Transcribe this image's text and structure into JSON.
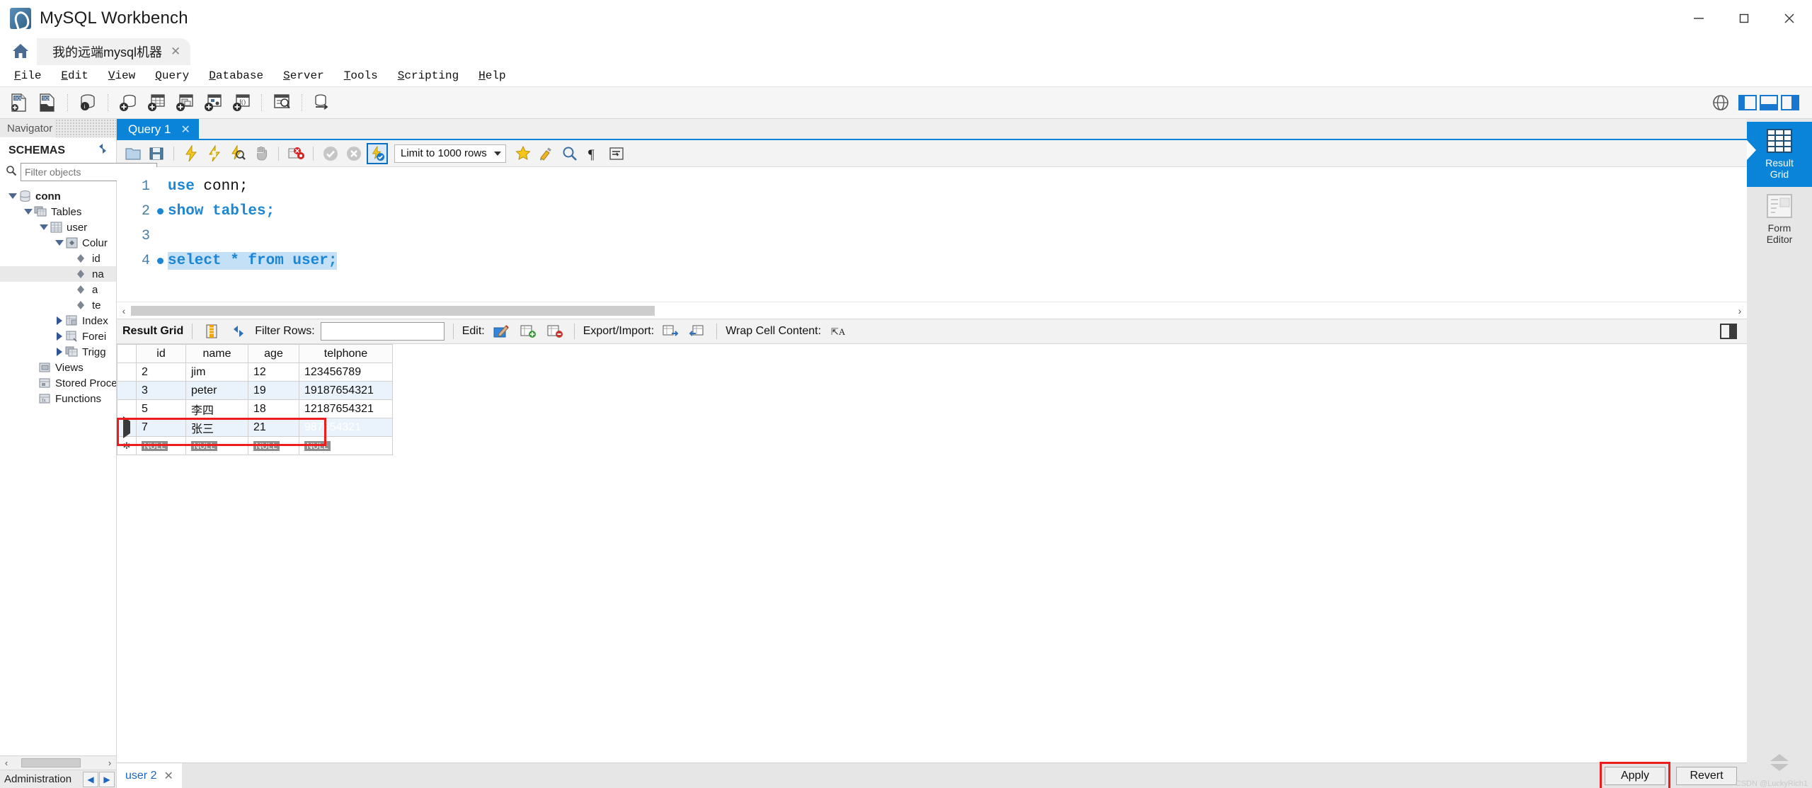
{
  "window": {
    "title": "MySQL Workbench",
    "minimize": "—",
    "maximize": "▢",
    "close": "✕"
  },
  "tabs": {
    "home_icon": "home-icon",
    "connection_tab": "我的远端mysql机器",
    "close_glyph": "✕"
  },
  "menu": [
    {
      "label": "File",
      "accel": "F"
    },
    {
      "label": "Edit",
      "accel": "E"
    },
    {
      "label": "View",
      "accel": "V"
    },
    {
      "label": "Query",
      "accel": "Q"
    },
    {
      "label": "Database",
      "accel": "D"
    },
    {
      "label": "Server",
      "accel": "S"
    },
    {
      "label": "Tools",
      "accel": "T"
    },
    {
      "label": "Scripting",
      "accel": "S"
    },
    {
      "label": "Help",
      "accel": "H"
    }
  ],
  "main_toolbar": {
    "buttons": [
      "new-sql-tab-icon",
      "open-sql-script-icon",
      "connect-to-database-icon",
      "new-schema-icon",
      "new-table-icon",
      "new-view-icon",
      "new-procedure-icon",
      "new-function-icon",
      "search-data-icon",
      "reconnect-to-server-icon"
    ],
    "right_icons": [
      "globe-icon",
      "panel-left-icon",
      "panel-bottom-icon",
      "panel-right-icon"
    ]
  },
  "navigator": {
    "header": "Navigator",
    "schemas_label": "SCHEMAS",
    "refresh_icon": "refresh-icon",
    "search_icon": "search-icon",
    "filter_placeholder": "Filter objects",
    "filter_value": "",
    "tree": [
      {
        "label": "conn",
        "indent": 0,
        "state": "expanded",
        "icon": "database-icon",
        "bold": true
      },
      {
        "label": "Tables",
        "indent": 1,
        "state": "expanded",
        "icon": "tables-icon",
        "bold": false
      },
      {
        "label": "user",
        "indent": 2,
        "state": "expanded",
        "icon": "table-icon",
        "bold": false
      },
      {
        "label": "Colur",
        "indent": 3,
        "state": "expanded",
        "icon": "columns-icon",
        "bold": false
      },
      {
        "label": "id",
        "indent": 4,
        "state": "leaf",
        "icon": "column-icon",
        "bold": false
      },
      {
        "label": "na",
        "indent": 4,
        "state": "leaf",
        "icon": "column-icon",
        "bold": false,
        "selected": true
      },
      {
        "label": "a",
        "indent": 4,
        "state": "leaf",
        "icon": "column-icon",
        "bold": false
      },
      {
        "label": "te",
        "indent": 4,
        "state": "leaf",
        "icon": "column-icon",
        "bold": false
      },
      {
        "label": "Index",
        "indent": 3,
        "state": "collapsed",
        "icon": "indexes-icon",
        "bold": false
      },
      {
        "label": "Forei",
        "indent": 3,
        "state": "collapsed",
        "icon": "foreign-keys-icon",
        "bold": false
      },
      {
        "label": "Trigg",
        "indent": 3,
        "state": "collapsed",
        "icon": "triggers-icon",
        "bold": false
      },
      {
        "label": "Views",
        "indent": 1,
        "state": "leaf",
        "icon": "views-icon",
        "bold": false
      },
      {
        "label": "Stored Proce",
        "indent": 1,
        "state": "leaf",
        "icon": "procedures-icon",
        "bold": false
      },
      {
        "label": "Functions",
        "indent": 1,
        "state": "leaf",
        "icon": "functions-icon",
        "bold": false
      }
    ],
    "admin_label": "Administration",
    "admin_prev_icon": "left-arrow-icon",
    "admin_next_icon": "right-arrow-icon",
    "scroll_left": "‹",
    "scroll_right": "›"
  },
  "query": {
    "tab_label": "Query 1",
    "tab_close": "✕",
    "toolbar": [
      "open-script-icon",
      "save-script-icon",
      "execute-icon",
      "execute-current-statement-icon",
      "explain-icon",
      "stop-icon",
      "toggle-breakpoint-icon",
      "commit-icon",
      "rollback-icon",
      "auto-commit-icon"
    ],
    "limit_label": "Limit to 1000 rows",
    "limit_caret": "▾",
    "after_limit_icons": [
      "favorite-icon",
      "beautify-icon",
      "find-icon",
      "toggle-invisible-icon",
      "wrap-lines-icon"
    ],
    "code_lines": [
      {
        "num": "1",
        "marker": false,
        "tokens": [
          {
            "t": "use",
            "c": "kw"
          },
          {
            "t": " ",
            "c": "sp"
          },
          {
            "t": "conn;",
            "c": "id"
          }
        ],
        "highlight": false
      },
      {
        "num": "2",
        "marker": true,
        "tokens": [
          {
            "t": "show tables;",
            "c": "kw"
          }
        ],
        "highlight": false
      },
      {
        "num": "3",
        "marker": false,
        "tokens": [],
        "highlight": false
      },
      {
        "num": "4",
        "marker": true,
        "tokens": [
          {
            "t": "select * from user;",
            "c": "kw"
          }
        ],
        "highlight": true
      }
    ],
    "scroll_left": "‹",
    "scroll_right": "›"
  },
  "result_toolbar": {
    "grid_label": "Result Grid",
    "field_types_icon": "field-types-icon",
    "refresh_icon": "refresh-icon",
    "filter_label": "Filter Rows:",
    "filter_value": "",
    "filter_placeholder": "",
    "edit_label": "Edit:",
    "edit_icons": [
      "edit-pencil-icon",
      "insert-row-icon",
      "delete-row-icon"
    ],
    "export_label": "Export/Import:",
    "export_icons": [
      "export-recordset-icon",
      "import-recordset-icon"
    ],
    "wrap_label": "Wrap Cell Content:",
    "wrap_icon": "wrap-text-icon",
    "split_icon": "split-panel-icon"
  },
  "result_grid": {
    "columns": [
      "id",
      "name",
      "age",
      "telphone"
    ],
    "rows": [
      {
        "id": "2",
        "name": "jim",
        "age": "12",
        "telphone": "123456789",
        "alt": false,
        "marker": ""
      },
      {
        "id": "3",
        "name": "peter",
        "age": "19",
        "telphone": "19187654321",
        "alt": true,
        "marker": ""
      },
      {
        "id": "5",
        "name": "李四",
        "age": "18",
        "telphone": "12187654321",
        "alt": false,
        "marker": ""
      },
      {
        "id": "7",
        "name": "张三",
        "age": "21",
        "telphone": "987654321",
        "alt": true,
        "marker": "▶",
        "selected_cell": "telphone",
        "highlighted_row": true
      }
    ],
    "null_row": {
      "id": "NULL",
      "name": "NULL",
      "age": "NULL",
      "telphone": "NULL",
      "marker": "✻"
    }
  },
  "right_panel": {
    "items": [
      {
        "label": "Result\nGrid",
        "icon": "result-grid-icon",
        "active": true
      },
      {
        "label": "Form\nEditor",
        "icon": "form-editor-icon",
        "active": false
      }
    ],
    "chevron_up": "chevron-up-icon",
    "chevron_down": "chevron-down-icon"
  },
  "bottom": {
    "tab_label": "user 2",
    "tab_close": "✕",
    "apply_label": "Apply",
    "revert_label": "Revert",
    "watermark": "CSDN @LuckyRich1"
  },
  "colors": {
    "accent": "#0a84d8",
    "keyword": "#1b86d4",
    "highlight": "#c3e0f7",
    "selection": "#1e7fd4",
    "red_box": "#ee1c1c"
  }
}
